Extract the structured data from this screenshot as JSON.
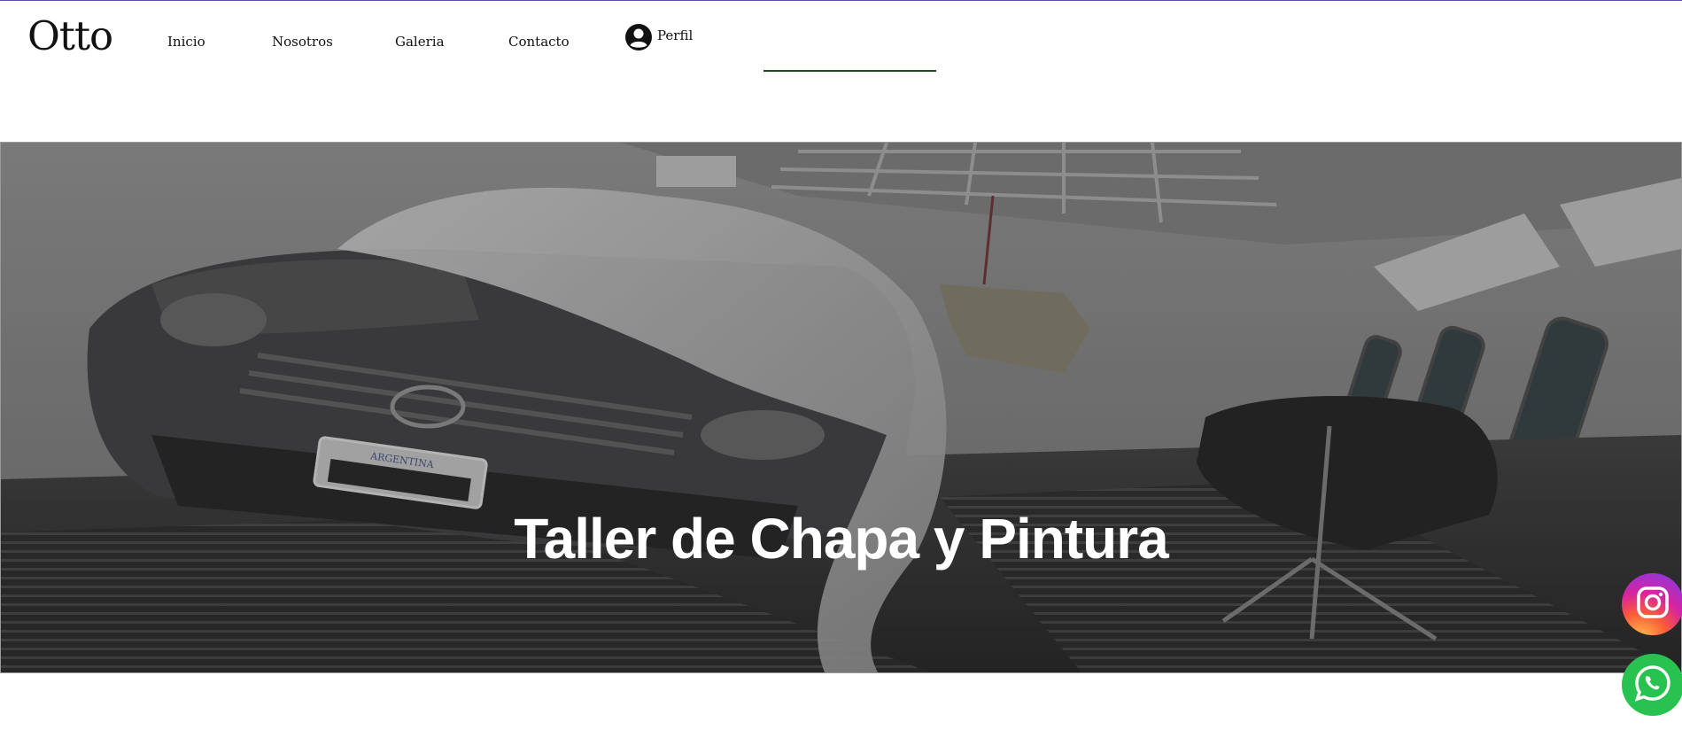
{
  "brand": {
    "logo": "Otto"
  },
  "nav": {
    "items": [
      {
        "label": "Inicio"
      },
      {
        "label": "Nosotros"
      },
      {
        "label": "Galeria"
      },
      {
        "label": "Contacto"
      }
    ],
    "profile_label": "Perfil"
  },
  "hero": {
    "title": "Taller de Chapa y Pintura",
    "plate_text": "ARGENTINA"
  },
  "floating": {
    "instagram_icon": "instagram-icon",
    "whatsapp_icon": "whatsapp-icon"
  },
  "colors": {
    "top_rule": "#5b4db3",
    "nav_underline": "#1f4d1f",
    "whatsapp": "#27c24f"
  }
}
